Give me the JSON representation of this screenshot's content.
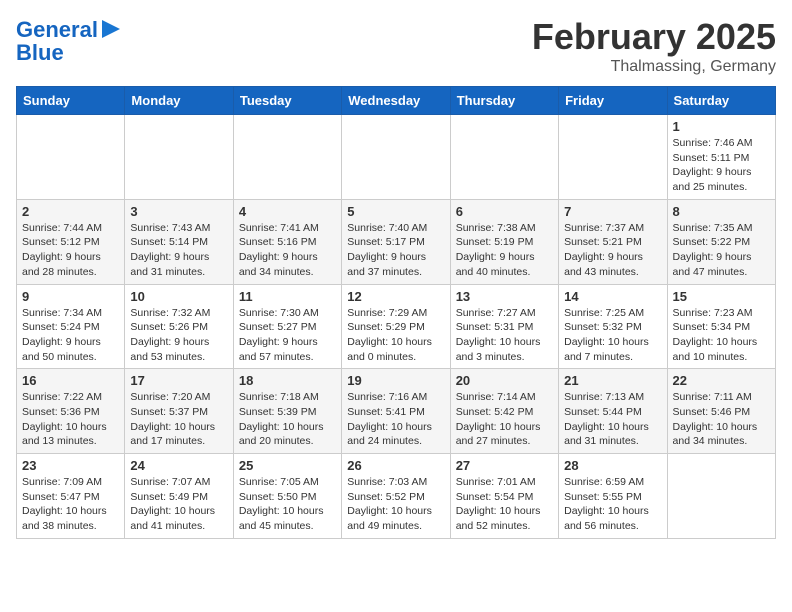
{
  "logo": {
    "line1": "General",
    "line2": "Blue"
  },
  "title": "February 2025",
  "location": "Thalmassing, Germany",
  "weekdays": [
    "Sunday",
    "Monday",
    "Tuesday",
    "Wednesday",
    "Thursday",
    "Friday",
    "Saturday"
  ],
  "weeks": [
    [
      {
        "day": "",
        "info": ""
      },
      {
        "day": "",
        "info": ""
      },
      {
        "day": "",
        "info": ""
      },
      {
        "day": "",
        "info": ""
      },
      {
        "day": "",
        "info": ""
      },
      {
        "day": "",
        "info": ""
      },
      {
        "day": "1",
        "info": "Sunrise: 7:46 AM\nSunset: 5:11 PM\nDaylight: 9 hours and 25 minutes."
      }
    ],
    [
      {
        "day": "2",
        "info": "Sunrise: 7:44 AM\nSunset: 5:12 PM\nDaylight: 9 hours and 28 minutes."
      },
      {
        "day": "3",
        "info": "Sunrise: 7:43 AM\nSunset: 5:14 PM\nDaylight: 9 hours and 31 minutes."
      },
      {
        "day": "4",
        "info": "Sunrise: 7:41 AM\nSunset: 5:16 PM\nDaylight: 9 hours and 34 minutes."
      },
      {
        "day": "5",
        "info": "Sunrise: 7:40 AM\nSunset: 5:17 PM\nDaylight: 9 hours and 37 minutes."
      },
      {
        "day": "6",
        "info": "Sunrise: 7:38 AM\nSunset: 5:19 PM\nDaylight: 9 hours and 40 minutes."
      },
      {
        "day": "7",
        "info": "Sunrise: 7:37 AM\nSunset: 5:21 PM\nDaylight: 9 hours and 43 minutes."
      },
      {
        "day": "8",
        "info": "Sunrise: 7:35 AM\nSunset: 5:22 PM\nDaylight: 9 hours and 47 minutes."
      }
    ],
    [
      {
        "day": "9",
        "info": "Sunrise: 7:34 AM\nSunset: 5:24 PM\nDaylight: 9 hours and 50 minutes."
      },
      {
        "day": "10",
        "info": "Sunrise: 7:32 AM\nSunset: 5:26 PM\nDaylight: 9 hours and 53 minutes."
      },
      {
        "day": "11",
        "info": "Sunrise: 7:30 AM\nSunset: 5:27 PM\nDaylight: 9 hours and 57 minutes."
      },
      {
        "day": "12",
        "info": "Sunrise: 7:29 AM\nSunset: 5:29 PM\nDaylight: 10 hours and 0 minutes."
      },
      {
        "day": "13",
        "info": "Sunrise: 7:27 AM\nSunset: 5:31 PM\nDaylight: 10 hours and 3 minutes."
      },
      {
        "day": "14",
        "info": "Sunrise: 7:25 AM\nSunset: 5:32 PM\nDaylight: 10 hours and 7 minutes."
      },
      {
        "day": "15",
        "info": "Sunrise: 7:23 AM\nSunset: 5:34 PM\nDaylight: 10 hours and 10 minutes."
      }
    ],
    [
      {
        "day": "16",
        "info": "Sunrise: 7:22 AM\nSunset: 5:36 PM\nDaylight: 10 hours and 13 minutes."
      },
      {
        "day": "17",
        "info": "Sunrise: 7:20 AM\nSunset: 5:37 PM\nDaylight: 10 hours and 17 minutes."
      },
      {
        "day": "18",
        "info": "Sunrise: 7:18 AM\nSunset: 5:39 PM\nDaylight: 10 hours and 20 minutes."
      },
      {
        "day": "19",
        "info": "Sunrise: 7:16 AM\nSunset: 5:41 PM\nDaylight: 10 hours and 24 minutes."
      },
      {
        "day": "20",
        "info": "Sunrise: 7:14 AM\nSunset: 5:42 PM\nDaylight: 10 hours and 27 minutes."
      },
      {
        "day": "21",
        "info": "Sunrise: 7:13 AM\nSunset: 5:44 PM\nDaylight: 10 hours and 31 minutes."
      },
      {
        "day": "22",
        "info": "Sunrise: 7:11 AM\nSunset: 5:46 PM\nDaylight: 10 hours and 34 minutes."
      }
    ],
    [
      {
        "day": "23",
        "info": "Sunrise: 7:09 AM\nSunset: 5:47 PM\nDaylight: 10 hours and 38 minutes."
      },
      {
        "day": "24",
        "info": "Sunrise: 7:07 AM\nSunset: 5:49 PM\nDaylight: 10 hours and 41 minutes."
      },
      {
        "day": "25",
        "info": "Sunrise: 7:05 AM\nSunset: 5:50 PM\nDaylight: 10 hours and 45 minutes."
      },
      {
        "day": "26",
        "info": "Sunrise: 7:03 AM\nSunset: 5:52 PM\nDaylight: 10 hours and 49 minutes."
      },
      {
        "day": "27",
        "info": "Sunrise: 7:01 AM\nSunset: 5:54 PM\nDaylight: 10 hours and 52 minutes."
      },
      {
        "day": "28",
        "info": "Sunrise: 6:59 AM\nSunset: 5:55 PM\nDaylight: 10 hours and 56 minutes."
      },
      {
        "day": "",
        "info": ""
      }
    ]
  ]
}
